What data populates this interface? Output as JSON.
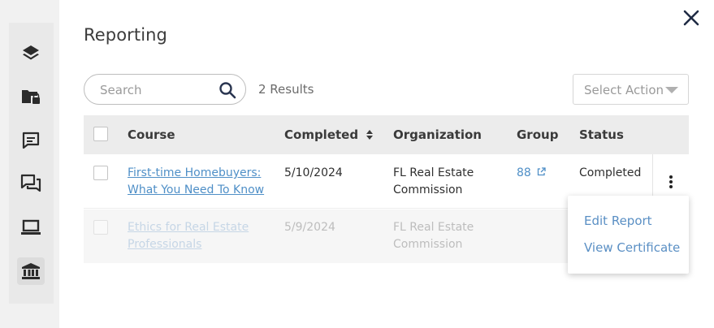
{
  "page": {
    "title": "Reporting"
  },
  "rail": {
    "icons": [
      "layers-icon",
      "locked-folder-icon",
      "comment-icon",
      "chat-icon",
      "laptop-icon",
      "institution-icon"
    ]
  },
  "toolbar": {
    "search_placeholder": "Search",
    "results_text": "2 Results",
    "action_placeholder": "Select Action"
  },
  "table": {
    "headers": {
      "course": "Course",
      "completed": "Completed",
      "organization": "Organization",
      "group": "Group",
      "status": "Status"
    },
    "rows": [
      {
        "course_line1": "First-time Homebuyers:",
        "course_line2": "What You Need To Know",
        "completed": "5/10/2024",
        "org_line1": "FL Real Estate",
        "org_line2": "Commission",
        "group": "88",
        "status": "Completed"
      },
      {
        "course_line1": "Ethics for Real Estate",
        "course_line2": "Professionals",
        "completed": "5/9/2024",
        "org_line1": "FL Real Estate",
        "org_line2": "Commission",
        "group": "",
        "status": ""
      }
    ]
  },
  "row_menu": {
    "items": [
      "Edit Report",
      "View Certificate"
    ]
  },
  "colors": {
    "link": "#4f8fc7",
    "header_bg": "#ececec",
    "rail_bg": "#e9e9e9"
  }
}
